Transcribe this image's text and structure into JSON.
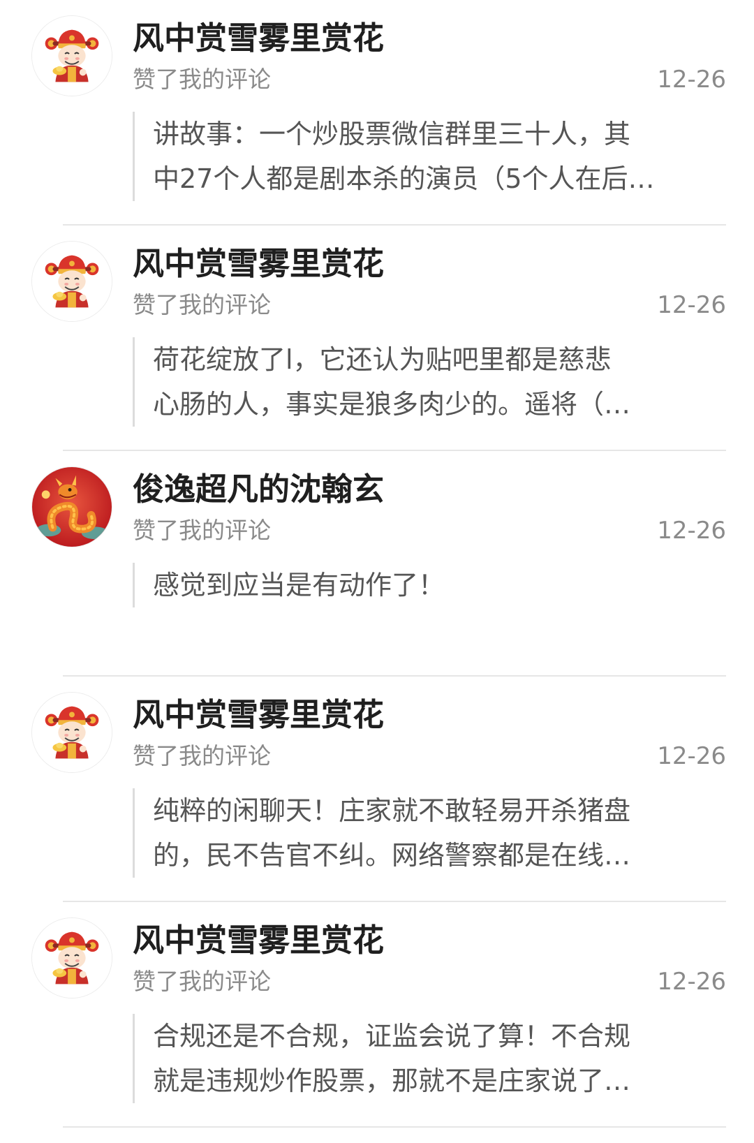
{
  "notifications": [
    {
      "username": "风中赏雪雾里赏花",
      "action": "赞了我的评论",
      "date": "12-26",
      "avatar": "caishen-avatar-icon",
      "comment_lines": [
        "讲故事：一个炒股票微信群里三十人，其",
        "中27个人都是剧本杀的演员（5个人在后…"
      ]
    },
    {
      "username": "风中赏雪雾里赏花",
      "action": "赞了我的评论",
      "date": "12-26",
      "avatar": "caishen-avatar-icon",
      "comment_lines": [
        "荷花绽放了l，它还认为贴吧里都是慈悲",
        "心肠的人，事实是狼多肉少的。遥将（…"
      ]
    },
    {
      "username": "俊逸超凡的沈翰玄",
      "action": "赞了我的评论",
      "date": "12-26",
      "avatar": "dragon-avatar-icon",
      "comment_lines": [
        "感觉到应当是有动作了！"
      ]
    },
    {
      "username": "风中赏雪雾里赏花",
      "action": "赞了我的评论",
      "date": "12-26",
      "avatar": "caishen-avatar-icon",
      "comment_lines": [
        "纯粹的闲聊天！庄家就不敢轻易开杀猪盘",
        "的，民不告官不纠。网络警察都是在线…"
      ]
    },
    {
      "username": "风中赏雪雾里赏花",
      "action": "赞了我的评论",
      "date": "12-26",
      "avatar": "caishen-avatar-icon",
      "comment_lines": [
        "合规还是不合规，证监会说了算！不合规",
        "就是违规炒作股票，那就不是庄家说了…"
      ]
    }
  ],
  "colors": {
    "background": "#ffffff",
    "username": "#1f1f1f",
    "meta": "#8a8a8a",
    "comment_text": "#555555",
    "quote_bar": "#dcdcdc",
    "divider": "#e6e6e6"
  }
}
